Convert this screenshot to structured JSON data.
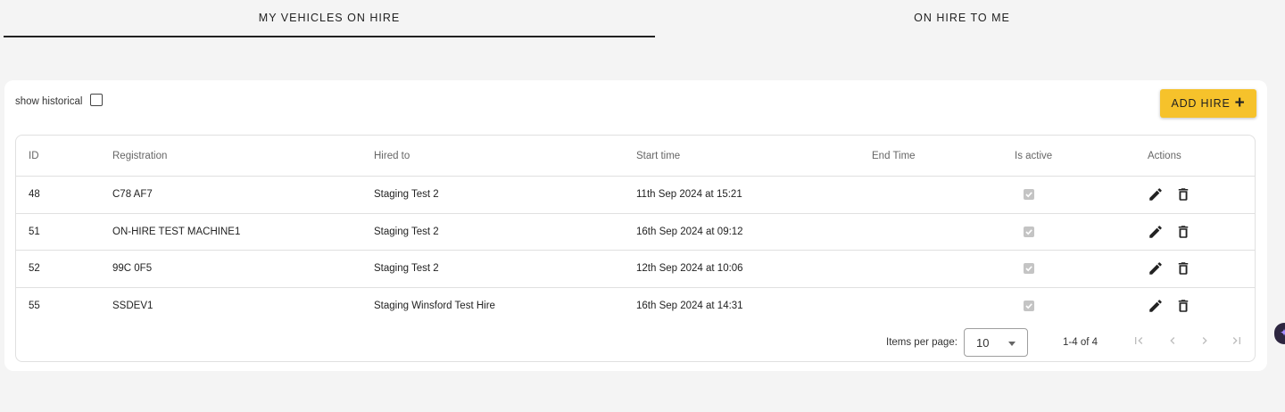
{
  "tabs": [
    {
      "label": "MY VEHICLES ON HIRE"
    },
    {
      "label": "ON HIRE TO ME"
    }
  ],
  "toolbar": {
    "show_historical_label": "show historical",
    "add_hire_label": "ADD HIRE"
  },
  "table": {
    "headers": {
      "id": "ID",
      "registration": "Registration",
      "hired_to": "Hired to",
      "start_time": "Start time",
      "end_time": "End Time",
      "is_active": "Is active",
      "actions": "Actions"
    },
    "rows": [
      {
        "id": "48",
        "registration": "C78 AF7",
        "hired_to": "Staging Test 2",
        "start_time": "11th Sep 2024 at 15:21",
        "end_time": "",
        "is_active": true
      },
      {
        "id": "51",
        "registration": "ON-HIRE TEST MACHINE1",
        "hired_to": "Staging Test 2",
        "start_time": "16th Sep 2024 at 09:12",
        "end_time": "",
        "is_active": true
      },
      {
        "id": "52",
        "registration": "99C 0F5",
        "hired_to": "Staging Test 2",
        "start_time": "12th Sep 2024 at 10:06",
        "end_time": "",
        "is_active": true
      },
      {
        "id": "55",
        "registration": "SSDEV1",
        "hired_to": "Staging Winsford Test Hire",
        "start_time": "16th Sep 2024 at 14:31",
        "end_time": "",
        "is_active": true
      }
    ]
  },
  "paginator": {
    "items_per_page_label": "Items per page:",
    "page_size": "10",
    "range_label": "1-4 of 4"
  },
  "colors": {
    "accent": "#f6c22b",
    "disabled_checkbox": "#c4c4c4"
  },
  "icons": [
    "plus-icon",
    "edit-icon",
    "delete-icon",
    "first-page-icon",
    "previous-page-icon",
    "next-page-icon",
    "last-page-icon",
    "dropdown-arrow-icon"
  ]
}
